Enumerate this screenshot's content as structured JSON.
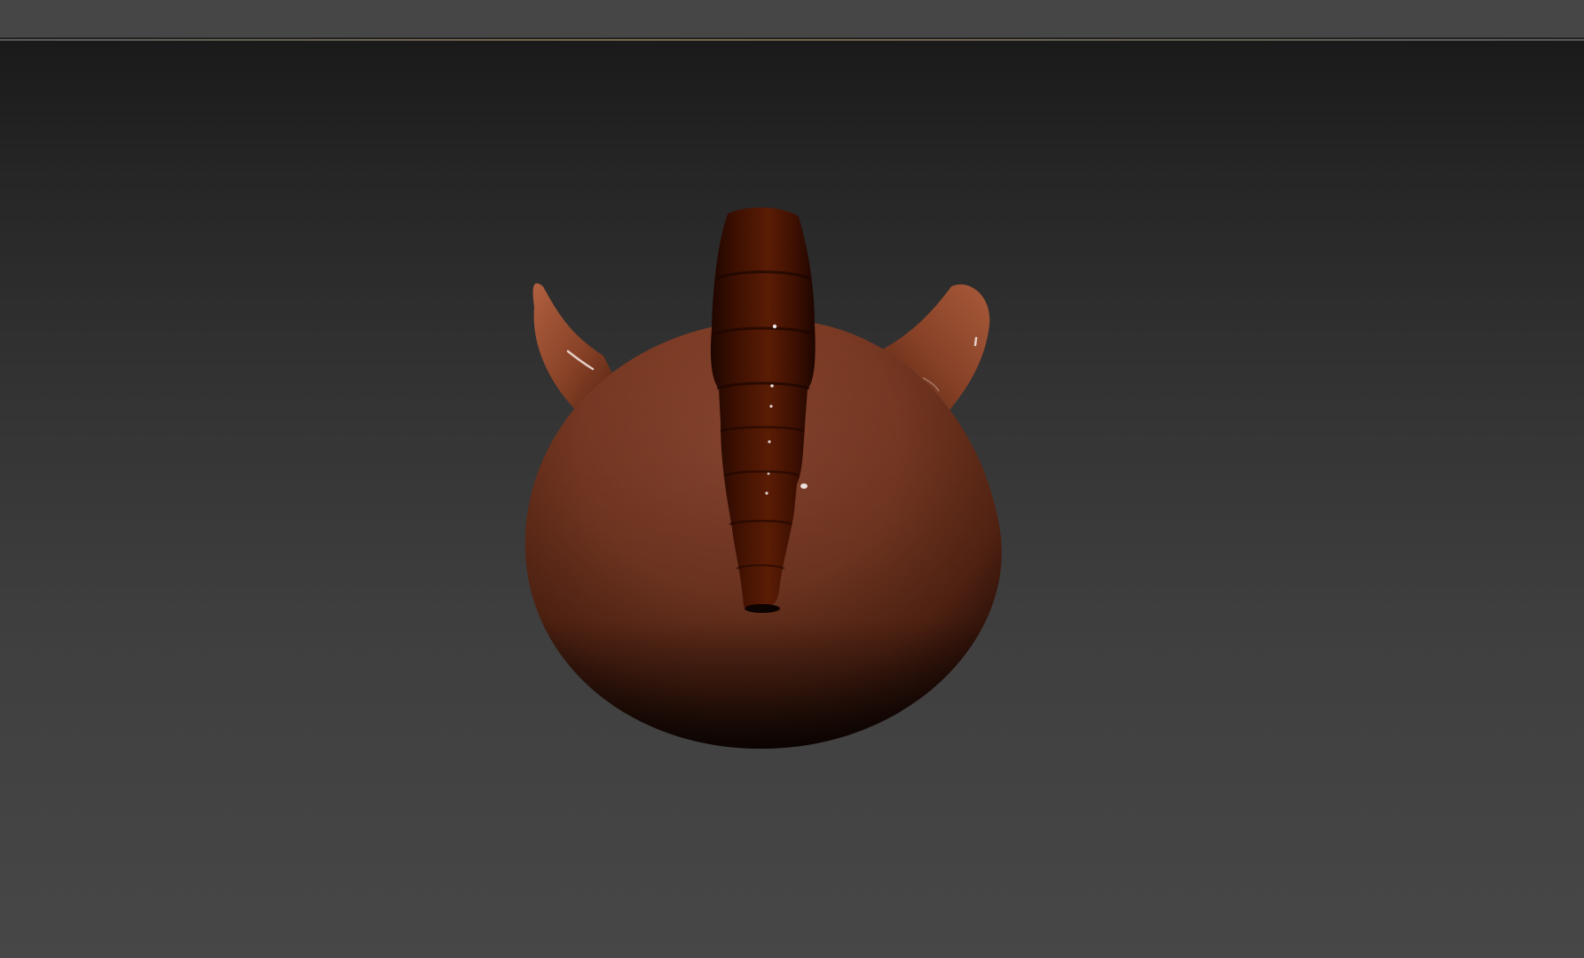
{
  "window": {
    "bar_color": "#464646",
    "viewport_top_color": "#1a1a1a",
    "viewport_bottom_color": "#474747"
  },
  "scene": {
    "object": "creature-back-view",
    "body_color": "#7a3a22",
    "horn_color": "#8a4328",
    "spine_color": "#4a1503"
  }
}
